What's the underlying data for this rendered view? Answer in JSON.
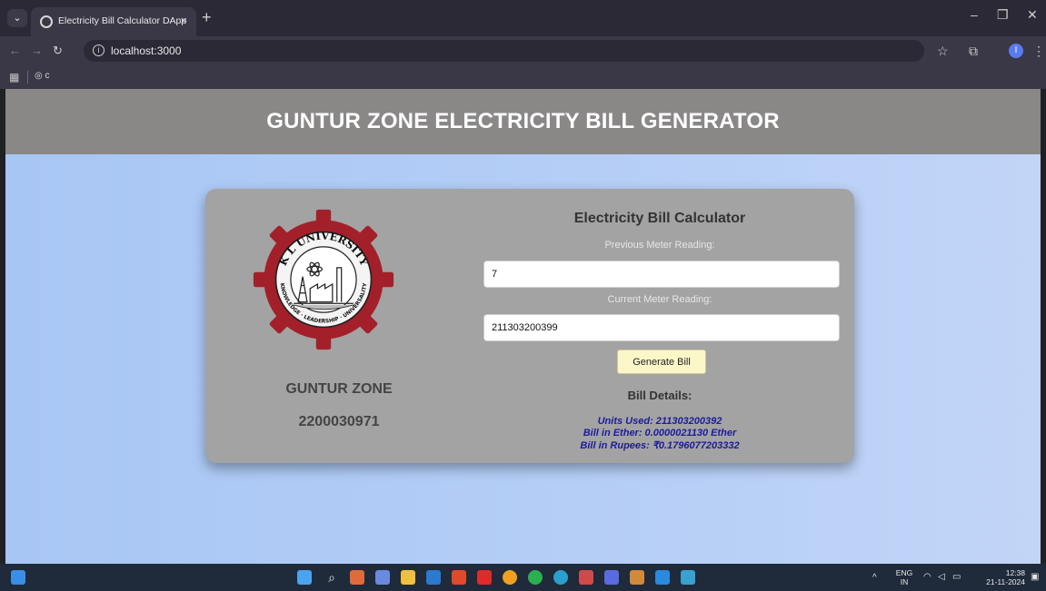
{
  "browser": {
    "tab_title": "Electricity Bill Calculator DApp",
    "url": "localhost:3000",
    "bookmark_label": "c"
  },
  "page": {
    "header_title": "GUNTUR ZONE ELECTRICITY BILL GENERATOR",
    "logo_text_top": "K L UNIVERSITY",
    "logo_text_bottom": "KNOWLEDGE · LEADERSHIP · UNIVERSALITY",
    "zone_name": "GUNTUR ZONE",
    "zone_id": "2200030971",
    "calculator": {
      "title": "Electricity Bill Calculator",
      "previous_label": "Previous Meter Reading:",
      "previous_value": "7",
      "current_label": "Current Meter Reading:",
      "current_value": "211303200399",
      "generate_label": "Generate Bill"
    },
    "bill_details": {
      "title": "Bill Details:",
      "units_used": "Units Used: 211303200392",
      "bill_ether": "Bill in Ether: 0.0000021130 Ether",
      "bill_rupees": "Bill in Rupees: ₹0.1796077203332"
    }
  },
  "taskbar": {
    "language": "ENG",
    "region": "IN",
    "time": "12:38",
    "date": "21-11-2024"
  },
  "colors": {
    "header_bg": "#8a8787",
    "card_bg": "#a3a3a3",
    "details_text": "#1c1c9e",
    "button_bg": "#fcf7c8",
    "logo_red": "#a3202a"
  }
}
